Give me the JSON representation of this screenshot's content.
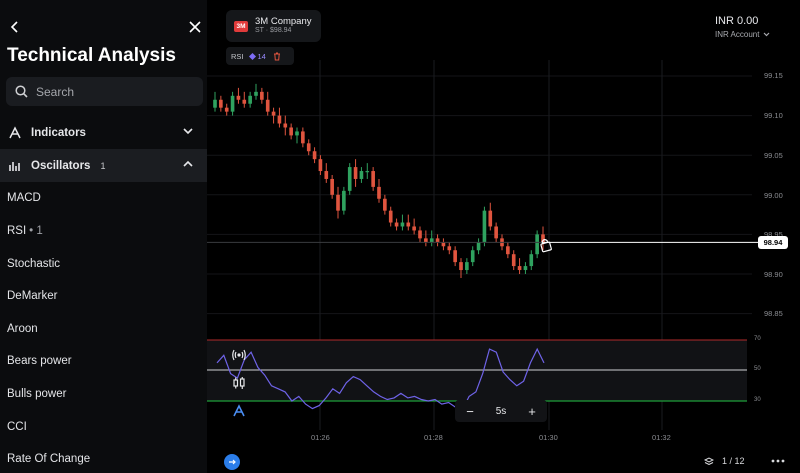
{
  "panel": {
    "title": "Technical Analysis",
    "search_placeholder": "Search",
    "sections": [
      {
        "label": "Indicators",
        "count": "",
        "expanded": false
      },
      {
        "label": "Oscillators",
        "count": "1",
        "expanded": true
      }
    ],
    "oscillators": [
      {
        "label": "MACD",
        "badge": ""
      },
      {
        "label": "RSI",
        "badge": "• 1"
      },
      {
        "label": "Stochastic",
        "badge": ""
      },
      {
        "label": "DeMarker",
        "badge": ""
      },
      {
        "label": "Aroon",
        "badge": ""
      },
      {
        "label": "Bears power",
        "badge": ""
      },
      {
        "label": "Bulls power",
        "badge": ""
      },
      {
        "label": "CCI",
        "badge": ""
      },
      {
        "label": "Rate Of Change",
        "badge": ""
      }
    ]
  },
  "asset": {
    "logo_text": "3M",
    "name": "3M Company",
    "sub": "ST · $98.94",
    "logo_color": "#e03b3b"
  },
  "indicator_chip": {
    "label": "RSI",
    "period": "14"
  },
  "account": {
    "balance": "INR 0.00",
    "label": "INR Account"
  },
  "price_axis": {
    "ticks": [
      "99.15",
      "99.10",
      "99.05",
      "99.00",
      "98.95",
      "98.90",
      "98.85"
    ],
    "current_price": "98.94"
  },
  "time_axis": {
    "ticks": [
      "01:26",
      "01:28",
      "01:30",
      "01:32"
    ]
  },
  "rsi_levels": [
    "70",
    "50",
    "30"
  ],
  "timeframe": {
    "value": "5s",
    "minus": "−",
    "plus": "+"
  },
  "pager": {
    "text": "1 / 12"
  },
  "colors": {
    "up": "#2fa25f",
    "down": "#e0553f",
    "rsi_line": "#6f63e8",
    "level_high": "#b12a2a",
    "level_low": "#1f9e3a",
    "accent": "#2b7de9"
  },
  "chart_data": {
    "type": "candlestick",
    "ylim": [
      98.825,
      99.17
    ],
    "xlim": [
      "01:24:55",
      "01:33:10"
    ],
    "candles": [
      [
        99.11,
        99.13,
        99.105,
        99.12
      ],
      [
        99.12,
        99.125,
        99.105,
        99.11
      ],
      [
        99.11,
        99.115,
        99.1,
        99.105
      ],
      [
        99.105,
        99.13,
        99.1,
        99.125
      ],
      [
        99.125,
        99.135,
        99.115,
        99.12
      ],
      [
        99.12,
        99.13,
        99.11,
        99.115
      ],
      [
        99.115,
        99.13,
        99.11,
        99.125
      ],
      [
        99.125,
        99.14,
        99.12,
        99.13
      ],
      [
        99.13,
        99.135,
        99.115,
        99.12
      ],
      [
        99.12,
        99.13,
        99.1,
        99.105
      ],
      [
        99.105,
        99.11,
        99.09,
        99.1
      ],
      [
        99.1,
        99.11,
        99.085,
        99.09
      ],
      [
        99.09,
        99.1,
        99.075,
        99.085
      ],
      [
        99.085,
        99.09,
        99.07,
        99.075
      ],
      [
        99.075,
        99.085,
        99.065,
        99.08
      ],
      [
        99.08,
        99.085,
        99.06,
        99.065
      ],
      [
        99.065,
        99.07,
        99.05,
        99.055
      ],
      [
        99.055,
        99.06,
        99.04,
        99.045
      ],
      [
        99.045,
        99.05,
        99.025,
        99.03
      ],
      [
        99.03,
        99.04,
        99.015,
        99.02
      ],
      [
        99.02,
        99.025,
        98.995,
        99.0
      ],
      [
        99.0,
        99.01,
        98.97,
        98.98
      ],
      [
        98.98,
        99.01,
        98.975,
        99.005
      ],
      [
        99.005,
        99.04,
        99.0,
        99.035
      ],
      [
        99.035,
        99.045,
        99.01,
        99.02
      ],
      [
        99.02,
        99.035,
        99.015,
        99.03
      ],
      [
        99.03,
        99.04,
        99.02,
        99.03
      ],
      [
        99.03,
        99.035,
        99.005,
        99.01
      ],
      [
        99.01,
        99.02,
        98.99,
        98.995
      ],
      [
        98.995,
        99.0,
        98.975,
        98.98
      ],
      [
        98.98,
        98.985,
        98.96,
        98.965
      ],
      [
        98.965,
        98.97,
        98.955,
        98.96
      ],
      [
        98.96,
        98.975,
        98.955,
        98.965
      ],
      [
        98.965,
        98.975,
        98.955,
        98.96
      ],
      [
        98.96,
        98.97,
        98.95,
        98.955
      ],
      [
        98.955,
        98.96,
        98.94,
        98.945
      ],
      [
        98.945,
        98.955,
        98.935,
        98.94
      ],
      [
        98.94,
        98.955,
        98.935,
        98.945
      ],
      [
        98.945,
        98.95,
        98.935,
        98.94
      ],
      [
        98.94,
        98.945,
        98.93,
        98.935
      ],
      [
        98.935,
        98.94,
        98.925,
        98.93
      ],
      [
        98.93,
        98.935,
        98.91,
        98.915
      ],
      [
        98.915,
        98.92,
        98.895,
        98.905
      ],
      [
        98.905,
        98.92,
        98.9,
        98.915
      ],
      [
        98.915,
        98.935,
        98.91,
        98.93
      ],
      [
        98.93,
        98.945,
        98.925,
        98.94
      ],
      [
        98.94,
        98.985,
        98.935,
        98.98
      ],
      [
        98.98,
        98.99,
        98.955,
        98.96
      ],
      [
        98.96,
        98.965,
        98.94,
        98.945
      ],
      [
        98.945,
        98.95,
        98.93,
        98.935
      ],
      [
        98.935,
        98.94,
        98.92,
        98.925
      ],
      [
        98.925,
        98.93,
        98.905,
        98.91
      ],
      [
        98.91,
        98.92,
        98.9,
        98.905
      ],
      [
        98.905,
        98.915,
        98.9,
        98.91
      ],
      [
        98.91,
        98.93,
        98.905,
        98.925
      ],
      [
        98.925,
        98.955,
        98.92,
        98.95
      ],
      [
        98.95,
        98.96,
        98.93,
        98.94
      ]
    ],
    "rsi": [
      55,
      60,
      48,
      45,
      57,
      62,
      52,
      47,
      40,
      38,
      36,
      30,
      33,
      28,
      25,
      27,
      32,
      38,
      35,
      42,
      46,
      44,
      40,
      36,
      33,
      31,
      32,
      35,
      32,
      33,
      31,
      30,
      31,
      28,
      29,
      26,
      24,
      33,
      36,
      48,
      64,
      62,
      49,
      44,
      40,
      43,
      55,
      64,
      55
    ]
  }
}
